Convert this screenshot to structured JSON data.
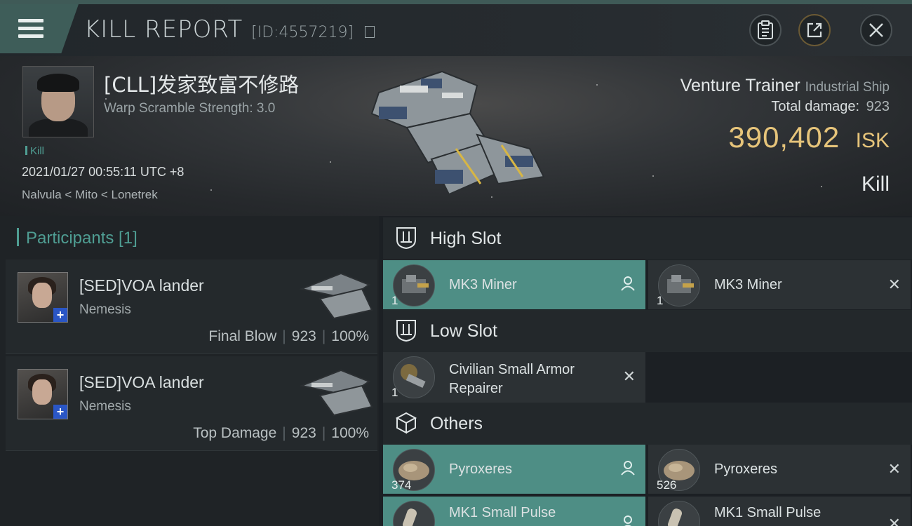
{
  "header": {
    "title": "KILL REPORT",
    "id_text": "[ID:4557219]"
  },
  "victim": {
    "name": "[CLL]发家致富不修路",
    "warp_scramble": "Warp Scramble Strength: 3.0",
    "kill_tag": "Kill",
    "datetime": "2021/01/27 00:55:11 UTC +8",
    "location": "Nalvula < Mito < Lonetrek"
  },
  "ship": {
    "name": "Venture Trainer",
    "class": "Industrial Ship",
    "total_damage_label": "Total damage:",
    "total_damage": "923",
    "isk_value": "390,402",
    "isk_label": "ISK",
    "result": "Kill"
  },
  "participants": {
    "heading": "Participants [1]",
    "items": [
      {
        "name": "[SED]VOA lander",
        "ship": "Nemesis",
        "role": "Final Blow",
        "damage": "923",
        "percent": "100%"
      },
      {
        "name": "[SED]VOA lander",
        "ship": "Nemesis",
        "role": "Top Damage",
        "damage": "923",
        "percent": "100%"
      }
    ]
  },
  "slots": {
    "high": {
      "label": "High Slot",
      "items": [
        {
          "name": "MK3 Miner",
          "qty": "1",
          "status": "dropped"
        },
        {
          "name": "MK3 Miner",
          "qty": "1",
          "status": "destroyed"
        }
      ]
    },
    "low": {
      "label": "Low Slot",
      "items": [
        {
          "name_line1": "Civilian Small Armor",
          "name_line2": "Repairer",
          "qty": "1",
          "status": "destroyed"
        }
      ]
    },
    "others": {
      "label": "Others",
      "items": [
        {
          "name": "Pyroxeres",
          "qty": "374",
          "status": "dropped"
        },
        {
          "name": "Pyroxeres",
          "qty": "526",
          "status": "destroyed"
        },
        {
          "name": "MK1 Small Pulse",
          "qty": "",
          "status": "dropped"
        },
        {
          "name": "MK1 Small Pulse",
          "qty": "",
          "status": "destroyed"
        }
      ]
    }
  },
  "colors": {
    "accent_teal": "#4f9e93",
    "highlight_row": "#4e8e85",
    "isk_gold": "#e6c47a"
  }
}
